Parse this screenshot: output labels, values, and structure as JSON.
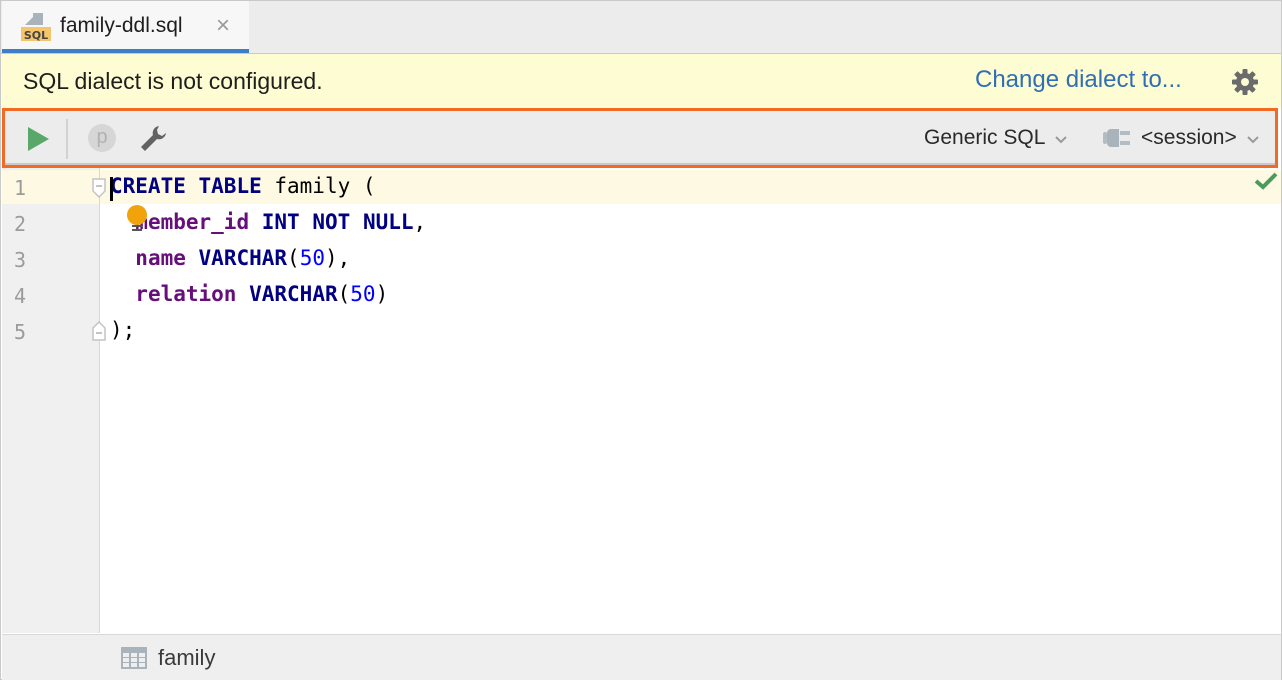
{
  "tabs": [
    {
      "label": "family-ddl.sql",
      "icon": "sql-file-icon",
      "active": true,
      "close_glyph": "×"
    }
  ],
  "banner": {
    "message": "SQL dialect is not configured.",
    "link_label": "Change dialect to...",
    "settings_icon": "gear-icon"
  },
  "toolbar": {
    "run_icon": "run-icon",
    "parameters_label": "p",
    "settings_icon": "wrench-icon",
    "dialect": "Generic SQL",
    "session": "<session>",
    "accent_color": "#f26a24"
  },
  "editor": {
    "lines": [
      {
        "number": "1",
        "tokens": [
          {
            "t": "CREATE",
            "c": "kw"
          },
          {
            "t": " "
          },
          {
            "t": "TABLE",
            "c": "kw"
          },
          {
            "t": " family ("
          }
        ]
      },
      {
        "number": "2",
        "tokens": [
          {
            "t": "  "
          },
          {
            "t": "member_id",
            "c": "col"
          },
          {
            "t": " "
          },
          {
            "t": "INT",
            "c": "kw"
          },
          {
            "t": " "
          },
          {
            "t": "NOT",
            "c": "kw"
          },
          {
            "t": " "
          },
          {
            "t": "NULL",
            "c": "kw"
          },
          {
            "t": ","
          }
        ]
      },
      {
        "number": "3",
        "tokens": [
          {
            "t": "  "
          },
          {
            "t": "name",
            "c": "col"
          },
          {
            "t": " "
          },
          {
            "t": "VARCHAR",
            "c": "kw"
          },
          {
            "t": "("
          },
          {
            "t": "50",
            "c": "num"
          },
          {
            "t": "),"
          }
        ]
      },
      {
        "number": "4",
        "tokens": [
          {
            "t": "  "
          },
          {
            "t": "relation",
            "c": "col"
          },
          {
            "t": " "
          },
          {
            "t": "VARCHAR",
            "c": "kw"
          },
          {
            "t": "("
          },
          {
            "t": "50",
            "c": "num"
          },
          {
            "t": ")"
          }
        ]
      },
      {
        "number": "5",
        "tokens": [
          {
            "t": ");"
          }
        ]
      }
    ],
    "status_icon": "check-icon"
  },
  "breadcrumb": {
    "items": [
      {
        "label": "family",
        "icon": "table-icon"
      }
    ]
  }
}
